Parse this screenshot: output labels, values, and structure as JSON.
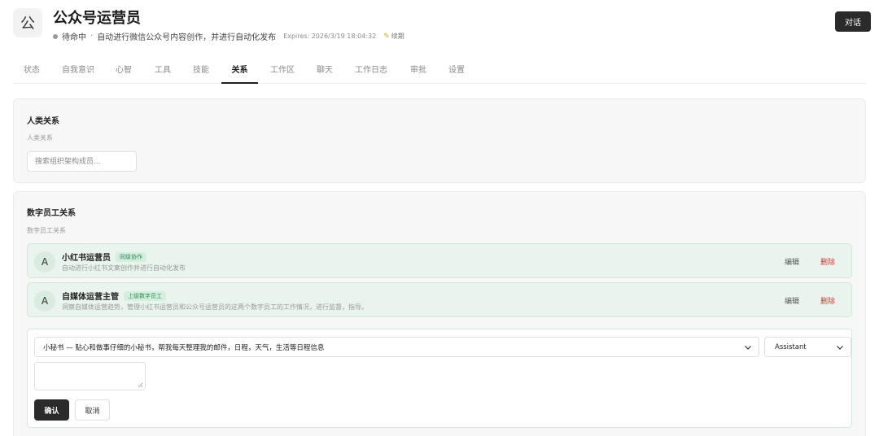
{
  "header": {
    "avatar_char": "公",
    "title": "公众号运营员",
    "status": "待命中",
    "separator": "·",
    "description": "自动进行微信公众号内容创作，并进行自动化发布",
    "expires": "Expires: 2026/3/19 18:04:32",
    "renew_label": "续期",
    "chat_button": "对话",
    "status_dot_color": "#9a9a9a",
    "pencil_icon": "pencil-icon"
  },
  "tabs": [
    {
      "label": "状态"
    },
    {
      "label": "自我意识"
    },
    {
      "label": "心智"
    },
    {
      "label": "工具"
    },
    {
      "label": "技能"
    },
    {
      "label": "关系",
      "active": true
    },
    {
      "label": "工作区"
    },
    {
      "label": "聊天"
    },
    {
      "label": "工作日志"
    },
    {
      "label": "审批"
    },
    {
      "label": "设置"
    }
  ],
  "human_relations": {
    "title": "人类关系",
    "subtitle": "人类关系",
    "search_placeholder": "搜索组织架构成员..."
  },
  "digital_relations": {
    "title": "数字员工关系",
    "subtitle": "数字员工关系",
    "items": [
      {
        "avatar": "A",
        "name": "小红书运营员",
        "badge": "同级协作",
        "description": "自动进行小红书文案创作并进行自动化发布",
        "edit": "编辑",
        "delete": "删除"
      },
      {
        "avatar": "A",
        "name": "自媒体运营主管",
        "badge": "上级数字员工",
        "description": "洞察自媒体运营趋势，管理小红书运营员和公众号运营员的这两个数字员工的工作情况，进行监督，指导。",
        "edit": "编辑",
        "delete": "删除"
      }
    ],
    "form": {
      "agent_select": "小秘书 — 贴心和做事仔细的小秘书，帮我每天整理我的邮件，日程，天气，生活等日程信息",
      "role_select": "Assistant",
      "textarea_value": "",
      "confirm": "确认",
      "cancel": "取消"
    }
  },
  "colors": {
    "accent_dark": "#2b2b2b",
    "relation_bg": "#eaf4ee",
    "badge_green": "#2f8a56",
    "delete_red": "#d03838"
  }
}
